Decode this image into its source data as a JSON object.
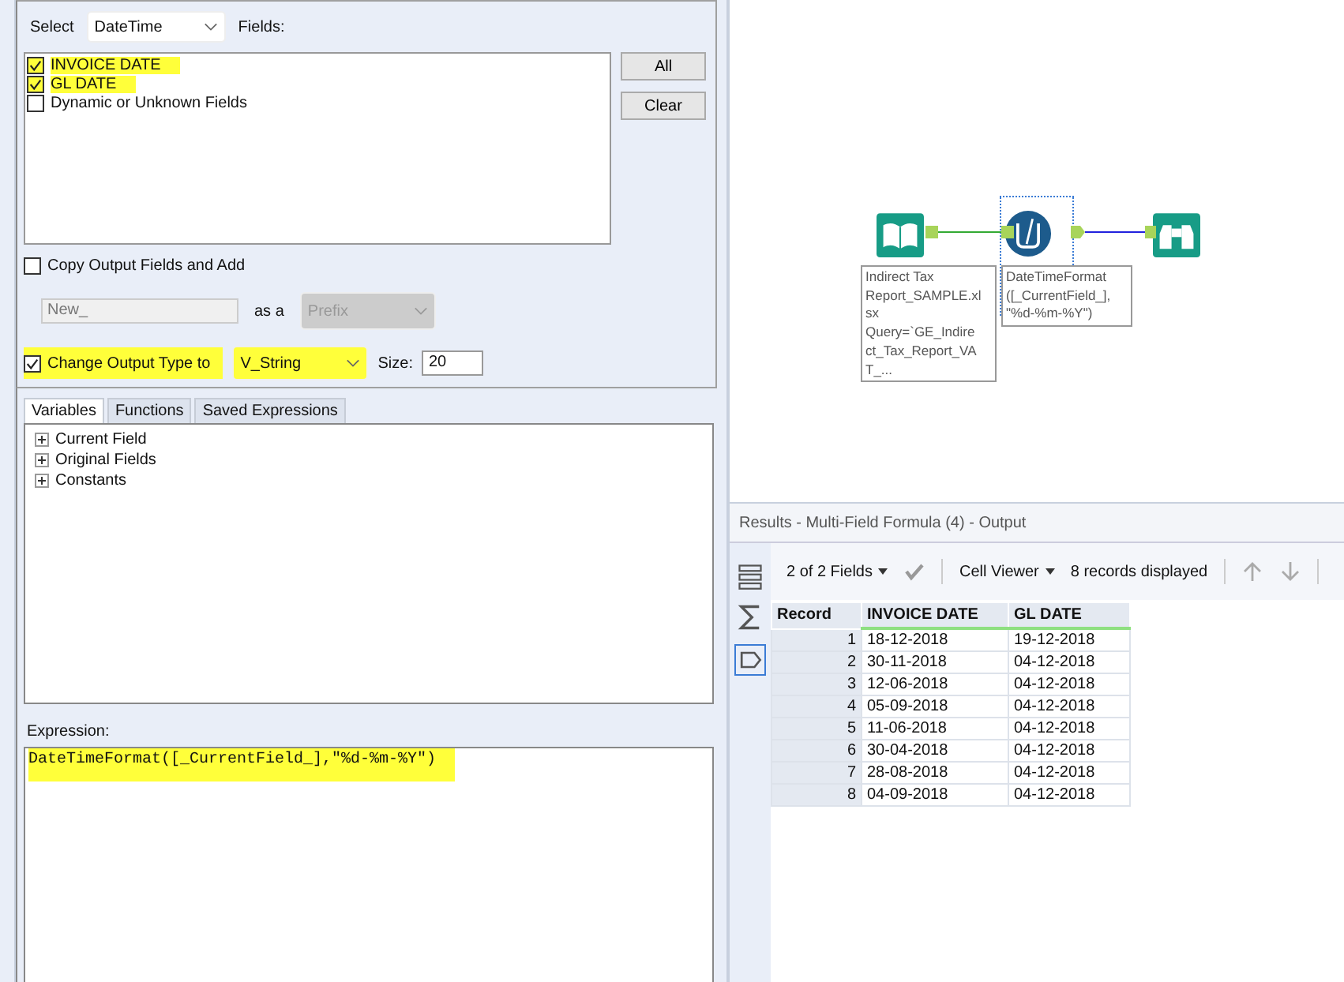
{
  "config": {
    "select_label": "Select",
    "select_value": "DateTime",
    "fields_label": "Fields:",
    "fields": [
      {
        "label": "INVOICE DATE",
        "checked": true,
        "highlighted": true
      },
      {
        "label": "GL DATE",
        "checked": true,
        "highlighted": true
      },
      {
        "label": "Dynamic or Unknown Fields",
        "checked": false,
        "highlighted": false
      }
    ],
    "buttons": [
      "All",
      "Clear"
    ],
    "copy_output": {
      "label": "Copy Output Fields and Add",
      "checked": false
    },
    "prefix_field": {
      "value": "New_",
      "disabled": true
    },
    "as_label": "as a",
    "prefix_select": {
      "value": "Prefix",
      "disabled": true
    },
    "change_type": {
      "label": "Change Output Type to",
      "checked": true,
      "highlighted": true,
      "value": "V_String"
    },
    "size_label": "Size:",
    "size_value": "20"
  },
  "tabs": [
    {
      "label": "Variables",
      "selected": true
    },
    {
      "label": "Functions",
      "selected": false
    },
    {
      "label": "Saved Expressions",
      "selected": false
    }
  ],
  "tree": [
    {
      "label": "Current Field",
      "expanded": false
    },
    {
      "label": "Original Fields",
      "expanded": false
    },
    {
      "label": "Constants",
      "expanded": false
    }
  ],
  "expression": {
    "label": "Expression:",
    "value": "DateTimeFormat([_CurrentField_],\"%d-%m-%Y\")",
    "highlighted": true
  },
  "workflow": {
    "nodes": [
      {
        "kind": "input",
        "selected": false,
        "annotation": [
          "Indirect Tax",
          "Report_SAMPLE.xl",
          "sx",
          "Query=`GE_Indire",
          "ct_Tax_Report_VA",
          "T_..."
        ]
      },
      {
        "kind": "formula",
        "selected": true,
        "annotation": [
          "DateTimeFormat",
          "([_CurrentField_],",
          "\"%d-%m-%Y\")"
        ]
      },
      {
        "kind": "browse",
        "selected": false
      }
    ]
  },
  "results": {
    "title": "Results - Multi-Field Formula (4) - Output",
    "fields_menu": "2 of 2 Fields",
    "viewer_menu": "Cell Viewer",
    "records_text": "8 records displayed",
    "columns": [
      "Record",
      "INVOICE DATE",
      "GL DATE"
    ],
    "rows": [
      [
        "1",
        "18-12-2018",
        "19-12-2018"
      ],
      [
        "2",
        "30-11-2018",
        "04-12-2018"
      ],
      [
        "3",
        "12-06-2018",
        "04-12-2018"
      ],
      [
        "4",
        "05-09-2018",
        "04-12-2018"
      ],
      [
        "5",
        "11-06-2018",
        "04-12-2018"
      ],
      [
        "6",
        "30-04-2018",
        "04-12-2018"
      ],
      [
        "7",
        "28-08-2018",
        "04-12-2018"
      ],
      [
        "8",
        "04-09-2018",
        "04-12-2018"
      ]
    ]
  }
}
